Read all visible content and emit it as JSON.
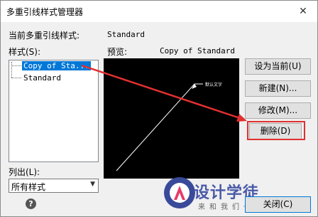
{
  "window": {
    "title": "多重引线样式管理器",
    "close_glyph": "✕"
  },
  "current_style": {
    "label": "当前多重引线样式:",
    "value": "Standard"
  },
  "styles": {
    "label": "样式(S):",
    "items": [
      "Copy of Sta...",
      "Standard"
    ]
  },
  "preview": {
    "label": "预览:",
    "value": "Copy of Standard",
    "leader_text": "默认文字"
  },
  "buttons": {
    "set_current": "设为当前(U)",
    "new": "新建(N)...",
    "modify": "修改(M)...",
    "delete": "删除(D)",
    "close": "关闭(C)"
  },
  "list_filter": {
    "label": "列出(L):",
    "value": "所有样式"
  },
  "help": {
    "glyph": "?"
  },
  "watermark": {
    "text": "设计学徒",
    "sub": "来和我们一起学"
  },
  "colors": {
    "highlight": "#e03030",
    "accent": "#0078d7"
  }
}
